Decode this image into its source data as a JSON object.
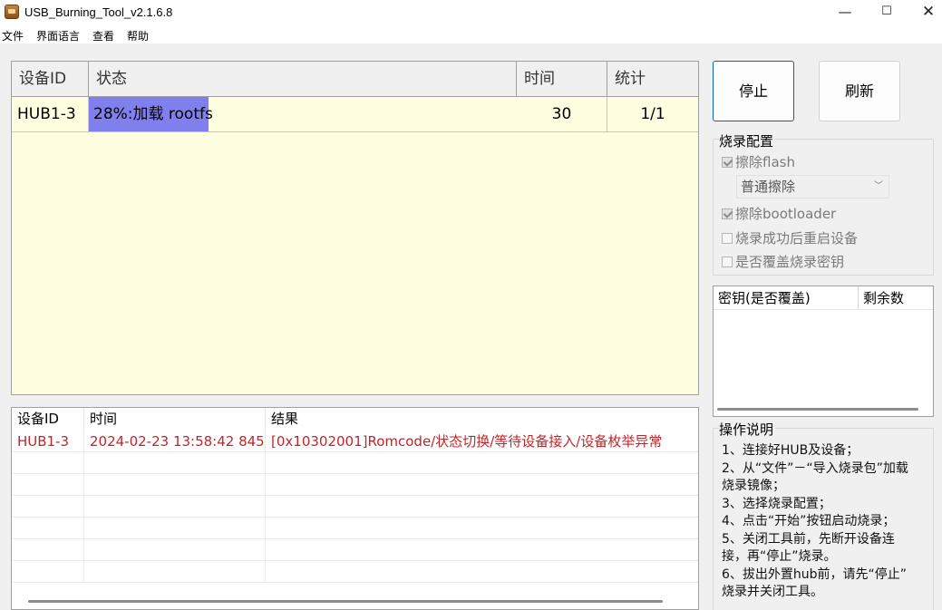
{
  "window": {
    "title": "USB_Burning_Tool_v2.1.6.8",
    "minimize": "—",
    "maximize": "☐",
    "close": "✕"
  },
  "menu": [
    "文件",
    "界面语言",
    "查看",
    "帮助"
  ],
  "device_table": {
    "headers": [
      "设备ID",
      "状态",
      "时间",
      "统计"
    ],
    "rows": [
      {
        "id": "HUB1-3",
        "status": "28%:加载 rootfs",
        "progress": 0.28,
        "time": "30",
        "count": "1/1"
      }
    ]
  },
  "buttons": {
    "stop": "停止",
    "refresh": "刷新"
  },
  "config": {
    "title": "烧录配置",
    "erase_flash": "擦除flash",
    "erase_mode": "普通擦除",
    "erase_bootloader": "擦除bootloader",
    "reboot_after": "烧录成功后重启设备",
    "overwrite_key": "是否覆盖烧录密钥"
  },
  "key_table": {
    "headers": [
      "密钥(是否覆盖)",
      "剩余数"
    ]
  },
  "help": {
    "title": "操作说明",
    "lines": [
      "1、连接好HUB及设备；",
      "2、从“文件”－“导入烧录包”加载",
      "烧录镜像；",
      "3、选择烧录配置；",
      "4、点击“开始”按钮启动烧录；",
      "5、关闭工具前，先断开设备连",
      "接，再“停止”烧录。",
      "6、拔出外置hub前，请先“停止”",
      "烧录并关闭工具。"
    ]
  },
  "log": {
    "headers": [
      "设备ID",
      "时间",
      "结果"
    ],
    "rows": [
      {
        "id": "HUB1-3",
        "time": "2024-02-23 13:58:42 845",
        "result": "[0x10302001]Romcode/状态切换/等待设备接入/设备枚举异常"
      }
    ]
  },
  "colors": {
    "progress": "#7f80ee",
    "table_bg": "#fffee0",
    "error_text": "#c0252a",
    "stop_border": "#0066b4"
  }
}
